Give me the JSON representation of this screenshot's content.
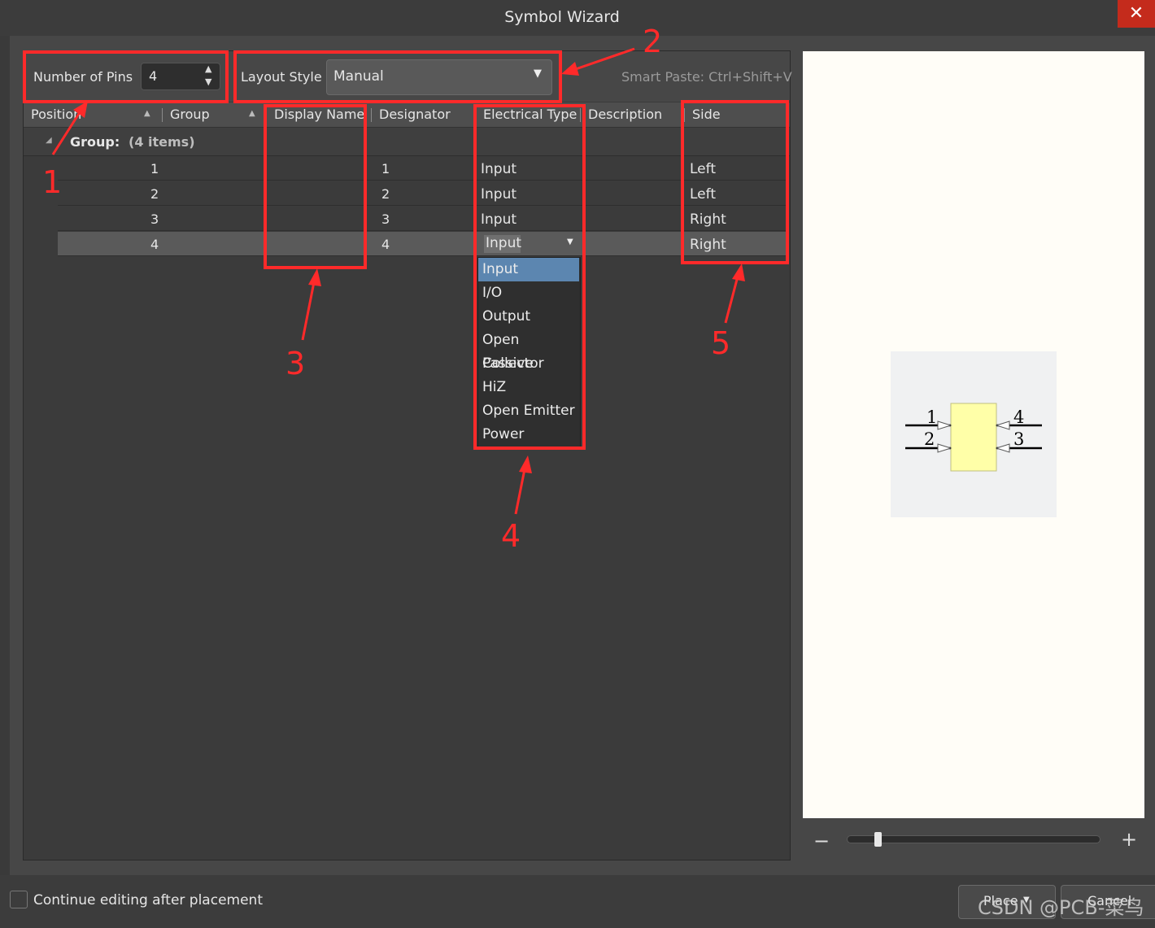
{
  "window": {
    "title": "Symbol Wizard",
    "close_glyph": "✕"
  },
  "toolbar": {
    "pins_label": "Number of Pins",
    "pins_value": "4",
    "layout_label": "Layout Style",
    "layout_value": "Manual",
    "smart_paste": "Smart Paste: Ctrl+Shift+V"
  },
  "columns": [
    "Position",
    "Group",
    "Display Name",
    "Designator",
    "Electrical Type",
    "Description",
    "Side"
  ],
  "group_row": {
    "label": "Group:",
    "count": "(4 items)"
  },
  "rows": [
    {
      "position": "1",
      "designator": "1",
      "electrical_type": "Input",
      "side": "Left"
    },
    {
      "position": "2",
      "designator": "2",
      "electrical_type": "Input",
      "side": "Left"
    },
    {
      "position": "3",
      "designator": "3",
      "electrical_type": "Input",
      "side": "Right"
    },
    {
      "position": "4",
      "designator": "4",
      "electrical_type": "Input",
      "side": "Right"
    }
  ],
  "electrical_type_options": [
    "Input",
    "I/O",
    "Output",
    "Open Collector",
    "Passive",
    "HiZ",
    "Open Emitter",
    "Power"
  ],
  "preview": {
    "pin_labels": [
      "1",
      "2",
      "4",
      "3"
    ],
    "body_color": "#ffffa8"
  },
  "footer": {
    "continue_label": "Continue editing after placement",
    "place_label": "Place",
    "cancel_label": "Cancel"
  },
  "annotations": [
    "1",
    "2",
    "3",
    "4",
    "5"
  ],
  "watermark": "CSDN @PCB-菜鸟",
  "colors": {
    "accent_selected": "#5c86b0",
    "annotation": "#ff2a2a",
    "close": "#c42b1c"
  }
}
